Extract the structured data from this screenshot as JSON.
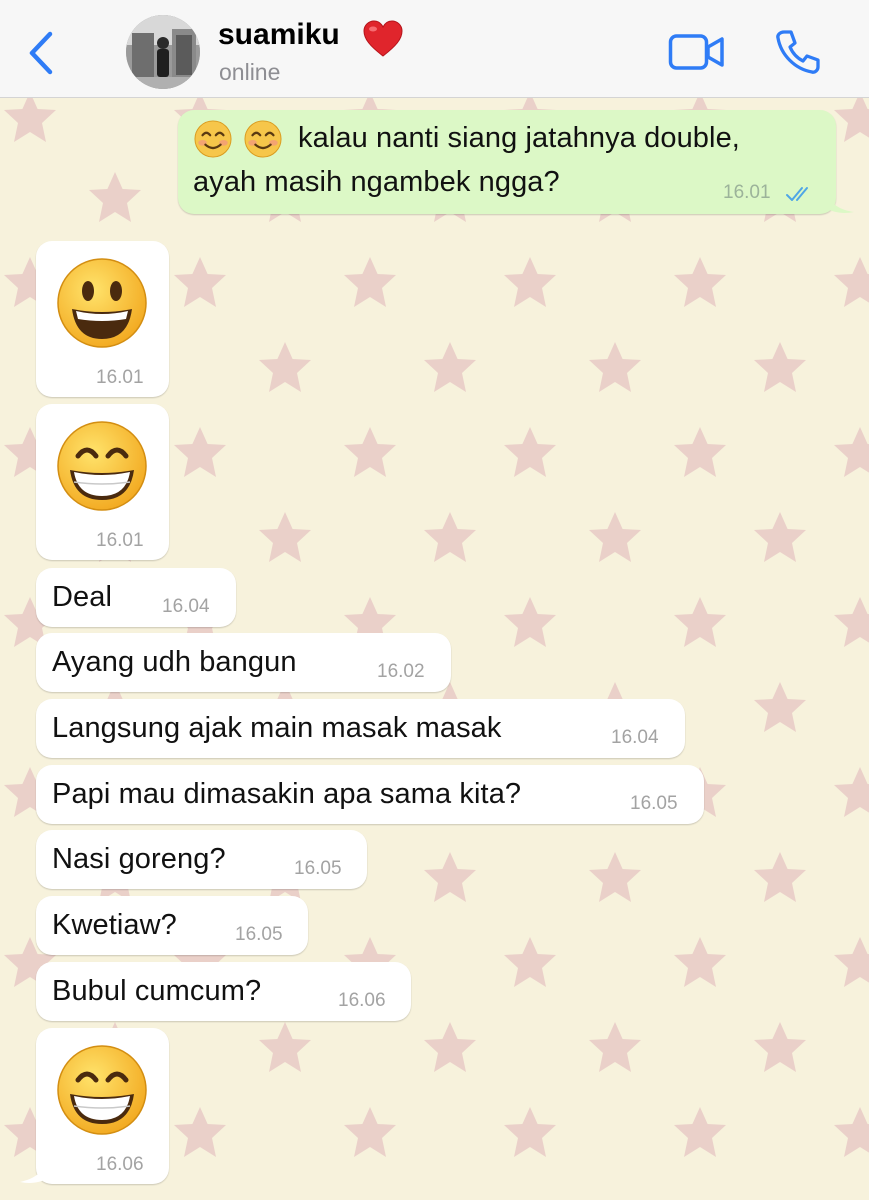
{
  "header": {
    "back_label": "<",
    "contact_name": "suamiku",
    "contact_badge": "heart-emoji",
    "status": "online",
    "actions": [
      "video-call-icon",
      "phone-call-icon"
    ],
    "accent_color": "#2f7cf6"
  },
  "messages": [
    {
      "direction": "out",
      "emojis": [
        "smiling-face-emoji",
        "smiling-face-emoji"
      ],
      "text_line1": "kalau nanti siang jatahnya double,",
      "text_line2": "ayah masih ngambek ngga?",
      "time": "16.01",
      "read": true
    },
    {
      "direction": "in",
      "emoji": "grinning-face-big-eyes-emoji",
      "time": "16.01"
    },
    {
      "direction": "in",
      "emoji": "grinning-face-smiling-eyes-emoji",
      "time": "16.01"
    },
    {
      "direction": "in",
      "text": "Deal",
      "time": "16.04"
    },
    {
      "direction": "in",
      "text": "Ayang udh bangun",
      "time": "16.02"
    },
    {
      "direction": "in",
      "text": "Langsung ajak main masak masak",
      "time": "16.04"
    },
    {
      "direction": "in",
      "text": "Papi mau dimasakin apa sama kita?",
      "time": "16.05"
    },
    {
      "direction": "in",
      "text": "Nasi goreng?",
      "time": "16.05"
    },
    {
      "direction": "in",
      "text": "Kwetiaw?",
      "time": "16.05"
    },
    {
      "direction": "in",
      "text": "Bubul cumcum?",
      "time": "16.06"
    },
    {
      "direction": "in",
      "emoji": "grinning-face-smiling-eyes-emoji",
      "time": "16.06"
    }
  ],
  "colors": {
    "wallpaper": "#f7f2dc",
    "wallpaper_star": "#e6c9c6",
    "outgoing_bubble": "#dcf8c6",
    "incoming_bubble": "#ffffff",
    "read_ticks": "#4fa6e6"
  }
}
